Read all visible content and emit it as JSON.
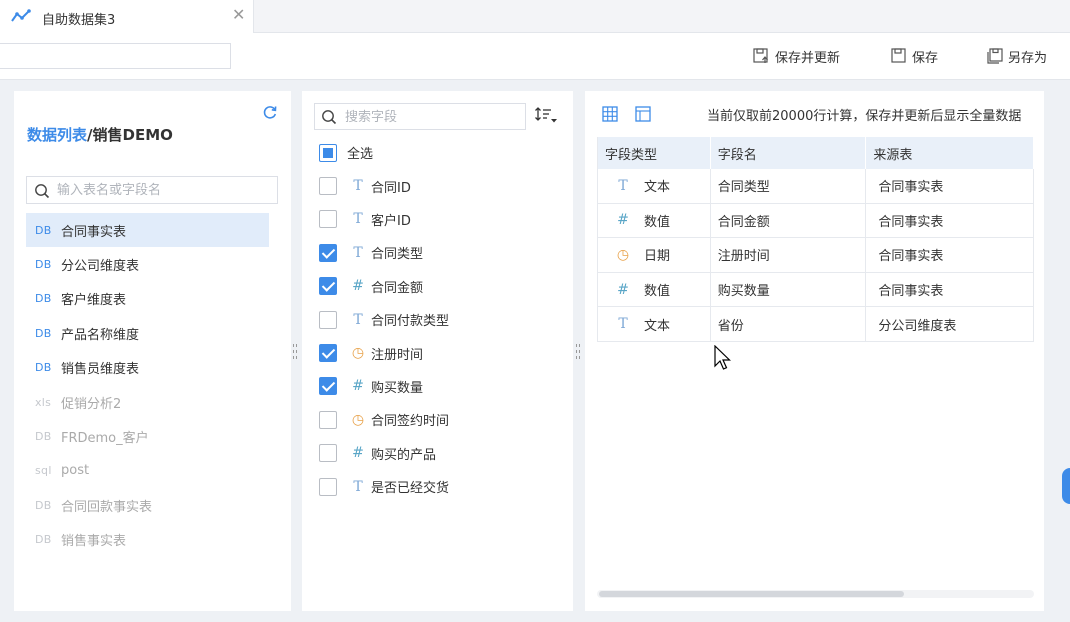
{
  "tab": {
    "title": "自助数据集3",
    "close": "✕"
  },
  "toolbar": {
    "save_update_label": "保存并更新",
    "save_label": "保存",
    "save_as_label": "另存为"
  },
  "left": {
    "breadcrumb_link": "数据列表",
    "breadcrumb_current": "/销售DEMO",
    "search_placeholder": "输入表名或字段名",
    "tables": [
      {
        "type": "DB",
        "name": "合同事实表",
        "state": "active"
      },
      {
        "type": "DB",
        "name": "分公司维度表",
        "state": "normal"
      },
      {
        "type": "DB",
        "name": "客户维度表",
        "state": "normal"
      },
      {
        "type": "DB",
        "name": "产品名称维度",
        "state": "normal"
      },
      {
        "type": "DB",
        "name": "销售员维度表",
        "state": "normal"
      },
      {
        "type": "xls",
        "name": "促销分析2",
        "state": "disabled"
      },
      {
        "type": "DB",
        "name": "FRDemo_客户",
        "state": "disabled"
      },
      {
        "type": "sql",
        "name": "post",
        "state": "disabled"
      },
      {
        "type": "DB",
        "name": "合同回款事实表",
        "state": "disabled"
      },
      {
        "type": "DB",
        "name": "销售事实表",
        "state": "disabled"
      }
    ]
  },
  "middle": {
    "search_placeholder": "搜索字段",
    "select_all_label": "全选",
    "fields": [
      {
        "kind": "text",
        "icon": "T",
        "name": "合同ID",
        "checked": false
      },
      {
        "kind": "text",
        "icon": "T",
        "name": "客户ID",
        "checked": false
      },
      {
        "kind": "text",
        "icon": "T",
        "name": "合同类型",
        "checked": true
      },
      {
        "kind": "num",
        "icon": "#",
        "name": "合同金额",
        "checked": true
      },
      {
        "kind": "text",
        "icon": "T",
        "name": "合同付款类型",
        "checked": false
      },
      {
        "kind": "date",
        "icon": "◷",
        "name": "注册时间",
        "checked": true
      },
      {
        "kind": "num",
        "icon": "#",
        "name": "购买数量",
        "checked": true
      },
      {
        "kind": "date",
        "icon": "◷",
        "name": "合同签约时间",
        "checked": false
      },
      {
        "kind": "num",
        "icon": "#",
        "name": "购买的产品",
        "checked": false
      },
      {
        "kind": "text",
        "icon": "T",
        "name": "是否已经交货",
        "checked": false
      }
    ]
  },
  "right": {
    "notice": "当前仅取前20000行计算，保存并更新后显示全量数据",
    "columns": [
      "字段类型",
      "字段名",
      "来源表"
    ],
    "rows": [
      {
        "kind": "text",
        "icon": "T",
        "type": "文本",
        "field": "合同类型",
        "source": "合同事实表"
      },
      {
        "kind": "num",
        "icon": "#",
        "type": "数值",
        "field": "合同金额",
        "source": "合同事实表"
      },
      {
        "kind": "date",
        "icon": "◷",
        "type": "日期",
        "field": "注册时间",
        "source": "合同事实表"
      },
      {
        "kind": "num",
        "icon": "#",
        "type": "数值",
        "field": "购买数量",
        "source": "合同事实表"
      },
      {
        "kind": "text",
        "icon": "T",
        "type": "文本",
        "field": "省份",
        "source": "分公司维度表"
      }
    ]
  },
  "colors": {
    "accent": "#3d8be8",
    "active_row": "#e1ecfa",
    "date_icon": "#e8a24a",
    "number_icon": "#5aa6c7"
  }
}
